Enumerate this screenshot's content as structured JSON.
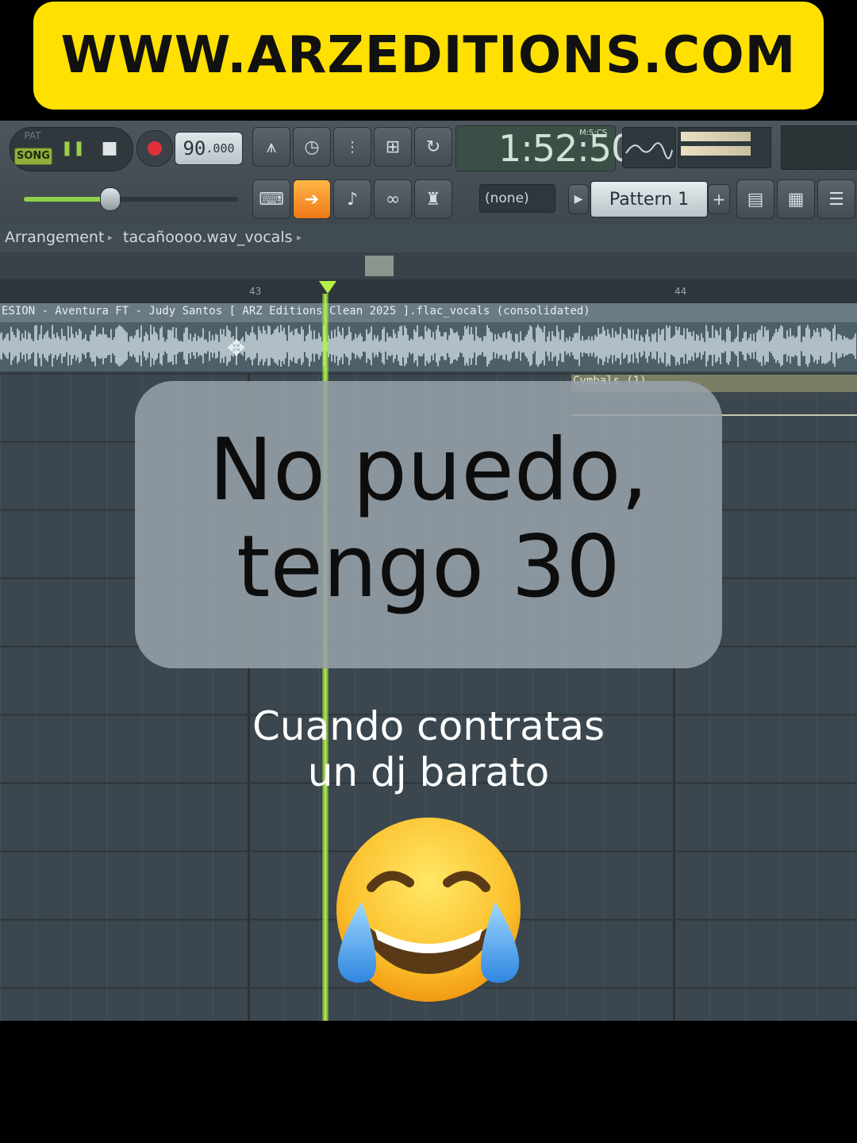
{
  "banner": {
    "text": "WWW.ARZEDITIONS.COM",
    "bg_color": "#ffe000"
  },
  "toolbar": {
    "pat_label": "PAT",
    "song_label": "SONG",
    "tempo_main": "90",
    "tempo_frac": ".000",
    "time_main": "1:52:50",
    "time_label": "M:S:CS",
    "none_select": "(none)",
    "pattern_select": "Pattern 1",
    "master_volume_fraction": 0.4
  },
  "breadcrumb": {
    "root": "Arrangement",
    "item": "tacañoooo.wav_vocals"
  },
  "timeline": {
    "bar_labels": [
      "43",
      "44"
    ],
    "clip_title": "ESION - Aventura FT - Judy Santos [ ARZ Editions Clean 2025 ].flac_vocals (consolidated)",
    "cymbals_clip": "Cymbals (1)",
    "playhead_color": "#b6f44c"
  },
  "overlay": {
    "caption_line1": "No puedo,",
    "caption_line2": "tengo 30",
    "sub_line1": "Cuando contratas",
    "sub_line2": "un dj barato",
    "emoji": "face-with-tears-of-joy"
  }
}
